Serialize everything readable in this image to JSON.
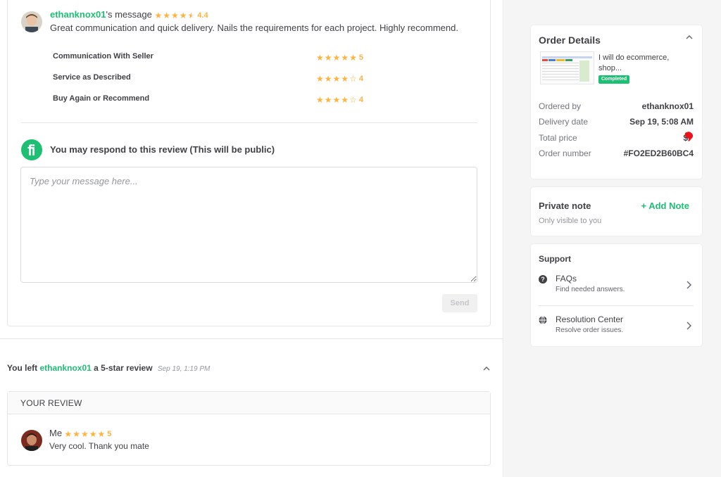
{
  "seller_review": {
    "username": "ethanknox01",
    "suffix": "'s message",
    "rating": "4.4",
    "message": "Great communication and quick delivery. Nails the requirements for each project. Highly recommend.",
    "breakdown": [
      {
        "label": "Communication With Seller",
        "stars": 5,
        "value": "5"
      },
      {
        "label": "Service as Described",
        "stars": 4,
        "value": "4"
      },
      {
        "label": "Buy Again or Recommend",
        "stars": 4,
        "value": "4"
      }
    ]
  },
  "respond": {
    "title": "You may respond to this review (This will be public)",
    "placeholder": "Type your message here...",
    "send_label": "Send"
  },
  "your_review_section": {
    "prefix": "You left ",
    "username": "ethanknox01",
    "suffix": " a 5-star review",
    "date": "Sep 19, 1:19 PM",
    "header": "YOUR REVIEW",
    "author": "Me",
    "rating": "5",
    "message": "Very cool. Thank you mate"
  },
  "order_details": {
    "title": "Order Details",
    "gig_title_line1": "I will do ecommerce,",
    "gig_title_line2": "shop...",
    "status": "Completed",
    "fields": [
      {
        "label": "Ordered by",
        "value": "ethanknox01"
      },
      {
        "label": "Delivery date",
        "value": "Sep 19, 5:08 AM"
      },
      {
        "label": "Total price",
        "value": "$"
      },
      {
        "label": "Order number",
        "value": "#FO2ED2B60BC4"
      }
    ]
  },
  "private_note": {
    "title": "Private note",
    "add_label": "+ Add Note",
    "subtitle": "Only visible to you"
  },
  "support": {
    "title": "Support",
    "items": [
      {
        "title": "FAQs",
        "subtitle": "Find needed answers."
      },
      {
        "title": "Resolution Center",
        "subtitle": "Resolve order issues."
      }
    ]
  },
  "colors": {
    "brand_green": "#1dbf73",
    "star": "#ffb33e",
    "redaction": "#e8141b"
  }
}
